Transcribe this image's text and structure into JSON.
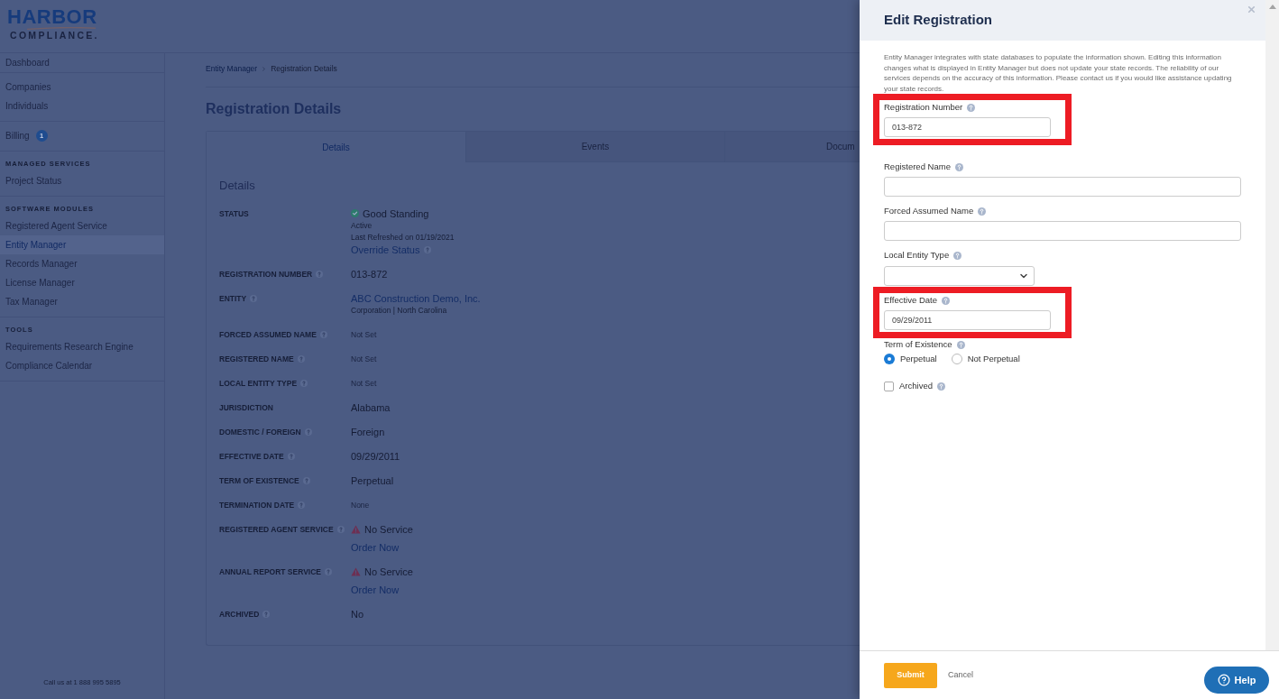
{
  "logo": {
    "name": "HARBOR",
    "tagline": "COMPLIANCE."
  },
  "sidebar": {
    "sections": [
      {
        "items": [
          {
            "label": "Dashboard",
            "selected": false
          }
        ]
      },
      {
        "items": [
          {
            "label": "Companies",
            "selected": false
          },
          {
            "label": "Individuals",
            "selected": false
          }
        ]
      },
      {
        "items": [
          {
            "label": "Billing",
            "selected": false,
            "badge": "1"
          }
        ]
      },
      {
        "heading": "MANAGED SERVICES",
        "items": [
          {
            "label": "Project Status",
            "selected": false
          }
        ]
      },
      {
        "heading": "SOFTWARE MODULES",
        "items": [
          {
            "label": "Registered Agent Service",
            "selected": false
          },
          {
            "label": "Entity Manager",
            "selected": true
          },
          {
            "label": "Records Manager",
            "selected": false
          },
          {
            "label": "License Manager",
            "selected": false
          },
          {
            "label": "Tax Manager",
            "selected": false
          }
        ]
      },
      {
        "heading": "TOOLS",
        "items": [
          {
            "label": "Requirements Research Engine",
            "selected": false
          },
          {
            "label": "Compliance Calendar",
            "selected": false
          }
        ]
      }
    ],
    "footer": "Call us at 1 888 995 5895"
  },
  "breadcrumb": [
    {
      "label": "Entity Manager",
      "kind": "link"
    },
    {
      "label": "Registration Details",
      "kind": "current"
    }
  ],
  "page_title": "Registration Details",
  "tabs": [
    {
      "label": "Details",
      "selected": true
    },
    {
      "label": "Events",
      "selected": false
    },
    {
      "label": "Docum",
      "selected": false
    }
  ],
  "details": {
    "heading": "Details",
    "rows": [
      {
        "label": "STATUS",
        "help": false,
        "kind": "status",
        "value": "Good Standing",
        "lines": [
          "Active",
          "Last Refreshed on 01/19/2021"
        ],
        "link": "Override Status",
        "link_help": true
      },
      {
        "label": "REGISTRATION NUMBER",
        "help": true,
        "kind": "text",
        "value": "013-872",
        "muted": false
      },
      {
        "label": "ENTITY",
        "help": true,
        "kind": "link",
        "value": "ABC Construction Demo, Inc.",
        "sub": "Corporation | North Carolina"
      },
      {
        "label": "FORCED ASSUMED NAME",
        "help": true,
        "kind": "text",
        "value": "Not Set",
        "muted": true
      },
      {
        "label": "REGISTERED NAME",
        "help": true,
        "kind": "text",
        "value": "Not Set",
        "muted": true
      },
      {
        "label": "LOCAL ENTITY TYPE",
        "help": true,
        "kind": "text",
        "value": "Not Set",
        "muted": true
      },
      {
        "label": "JURISDICTION",
        "help": false,
        "kind": "text",
        "value": "Alabama",
        "muted": false
      },
      {
        "label": "DOMESTIC / FOREIGN",
        "help": true,
        "kind": "text",
        "value": "Foreign",
        "muted": false
      },
      {
        "label": "EFFECTIVE DATE",
        "help": true,
        "kind": "text",
        "value": "09/29/2011",
        "muted": false
      },
      {
        "label": "TERM OF EXISTENCE",
        "help": true,
        "kind": "text",
        "value": "Perpetual",
        "muted": false
      },
      {
        "label": "TERMINATION DATE",
        "help": true,
        "kind": "text",
        "value": "None",
        "muted": true
      },
      {
        "label": "REGISTERED AGENT SERVICE",
        "help": true,
        "kind": "service",
        "value": "No Service",
        "link": "Order Now"
      },
      {
        "label": "ANNUAL REPORT SERVICE",
        "help": true,
        "kind": "service",
        "value": "No Service",
        "link": "Order Now"
      },
      {
        "label": "ARCHIVED",
        "help": true,
        "kind": "text",
        "value": "No",
        "muted": false
      }
    ]
  },
  "panel": {
    "title": "Edit Registration",
    "intro": "Entity Manager integrates with state databases to populate the information shown. Editing this information changes what is displayed in Entity Manager but does not update your state records. The reliability of our services depends on the accuracy of this information. Please contact us if you would like assistance updating your state records.",
    "fields": [
      {
        "kind": "input",
        "label": "Registration Number",
        "help": true,
        "value": "013-872",
        "highlighted": true
      },
      {
        "kind": "input",
        "label": "Registered Name",
        "help": true,
        "highlighted": false
      },
      {
        "kind": "input",
        "label": "Forced Assumed Name",
        "help": true,
        "highlighted": false
      },
      {
        "kind": "select",
        "label": "Local Entity Type",
        "help": true,
        "highlighted": false
      },
      {
        "kind": "input",
        "label": "Effective Date",
        "help": true,
        "value": "09/29/2011",
        "highlighted": true
      },
      {
        "kind": "radio",
        "label": "Term of Existence",
        "help": true,
        "options": [
          {
            "label": "Perpetual",
            "selected": true
          },
          {
            "label": "Not Perpetual",
            "selected": false
          }
        ]
      },
      {
        "kind": "checkbox",
        "label": "Archived",
        "help": true,
        "checked": false
      }
    ],
    "submit": "Submit",
    "cancel": "Cancel"
  },
  "help_button": "Help"
}
